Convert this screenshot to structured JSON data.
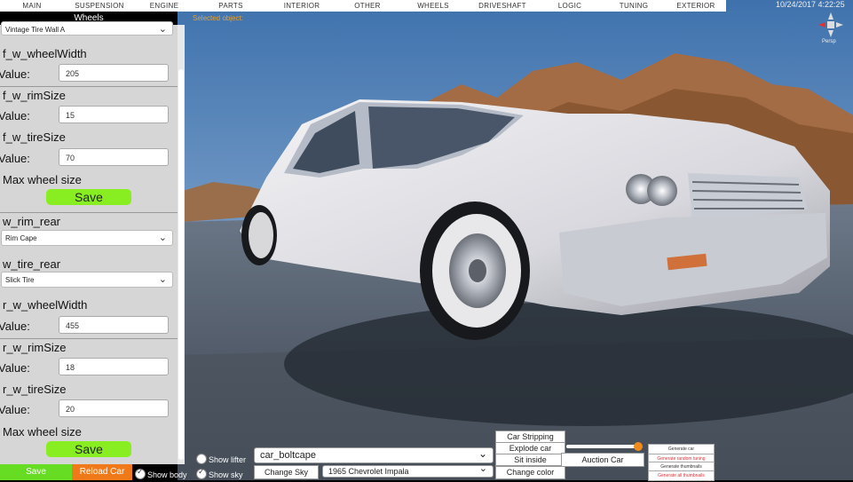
{
  "menu": [
    "MAIN",
    "SUSPENSION",
    "ENGINE",
    "PARTS",
    "INTERIOR",
    "OTHER",
    "WHEELS",
    "DRIVESHAFT",
    "LOGIC",
    "TUNING",
    "EXTERIOR"
  ],
  "datetime": "10/24/2017 4:22:25",
  "selected_object": "Selected object:",
  "persp": "Persp",
  "panel": {
    "title": "Wheels",
    "front_tire_dropdown": "Vintage Tire Wall A",
    "f_wheelWidth": {
      "label": "f_w_wheelWidth",
      "value_label": "Value:",
      "value": "205"
    },
    "f_rimSize": {
      "label": "f_w_rimSize",
      "value_label": "Value:",
      "value": "15"
    },
    "f_tireSize": {
      "label": "f_w_tireSize",
      "value_label": "Value:",
      "value": "70"
    },
    "f_max": {
      "label": "Max wheel size",
      "save": "Save"
    },
    "rear_rim": {
      "label": "w_rim_rear",
      "value": "Rim Cape"
    },
    "rear_tire": {
      "label": "w_tire_rear",
      "value": "Slick Tire"
    },
    "r_wheelWidth": {
      "label": "r_w_wheelWidth",
      "value_label": "Value:",
      "value": "455"
    },
    "r_rimSize": {
      "label": "r_w_rimSize",
      "value_label": "Value:",
      "value": "18"
    },
    "r_tireSize": {
      "label": "r_w_tireSize",
      "value_label": "Value:",
      "value": "20"
    },
    "r_max": {
      "label": "Max wheel size",
      "save": "Save"
    }
  },
  "bottom": {
    "save": "Save",
    "reload": "Reload Car",
    "show_body": "Show body",
    "show_lifter": "Show lifter",
    "show_sky": "Show sky",
    "car_name": "car_boltcape",
    "change_sky": "Change Sky",
    "car_model": "1965 Chevrolet Impala",
    "car_stripping": "Car Stripping",
    "explode_car": "Explode car",
    "sit_inside": "Sit inside",
    "change_color": "Change color",
    "auction_car": "Auction Car",
    "generate_car": "Generate car",
    "generate_random": "Generate random tuning",
    "generate_thumbnails": "Generate thumbnails",
    "generate_all_thumbnails": "Generate all thumbnails",
    "slider_level": 0.95
  }
}
